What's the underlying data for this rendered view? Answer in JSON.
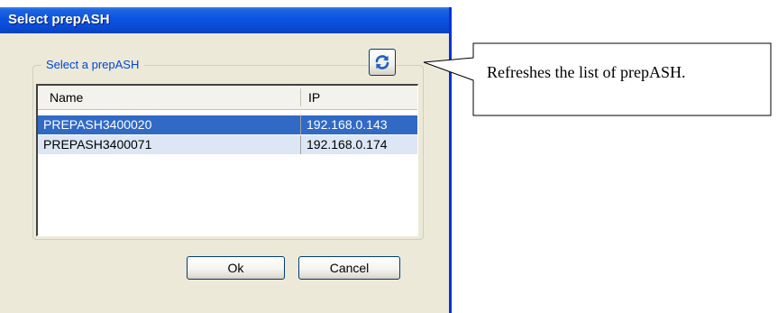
{
  "dialog": {
    "title": "Select prepASH",
    "group_label": "Select a prepASH",
    "refresh_icon": "refresh-icon",
    "list": {
      "columns": [
        "Name",
        "IP"
      ],
      "rows": [
        {
          "name": "PREPASH3400020",
          "ip": "192.168.0.143",
          "selected": true
        },
        {
          "name": "PREPASH3400071",
          "ip": "192.168.0.174",
          "selected": false
        }
      ]
    },
    "buttons": {
      "ok_label": "Ok",
      "cancel_label": "Cancel"
    }
  },
  "callout": {
    "text": "Refreshes the list of prepASH."
  },
  "colors": {
    "title_bar": "#0a54e3",
    "window_face": "#ece9d8",
    "selection": "#316ac5",
    "group_label": "#0046d5",
    "refresh_arrow": "#1f5fc7"
  }
}
